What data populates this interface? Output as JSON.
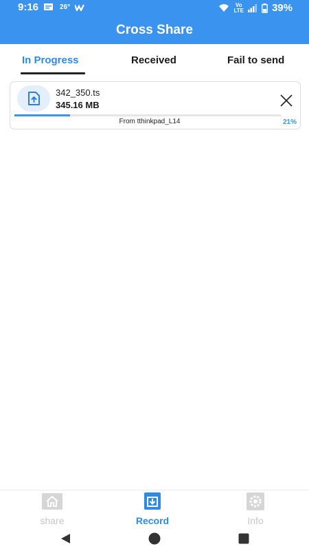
{
  "status_bar": {
    "time": "9:16",
    "temperature": "26°",
    "lte_top": "Vo",
    "lte_bottom": "LTE",
    "battery": "39%"
  },
  "header": {
    "title": "Cross Share",
    "background_color": "#3b93f0"
  },
  "tabs": [
    {
      "label": "In Progress",
      "active": true
    },
    {
      "label": "Received",
      "active": false
    },
    {
      "label": "Fail to send",
      "active": false
    }
  ],
  "transfer": {
    "file_name": "342_350.ts",
    "file_size": "345.16 MB",
    "from": "From tthinkpad_L14",
    "progress_label": "21%",
    "progress_fraction": 0.21,
    "icon": "file-upload-icon",
    "close_icon": "close-icon"
  },
  "bottom_nav": [
    {
      "label": "share",
      "icon": "home-icon",
      "active": false
    },
    {
      "label": "Record",
      "icon": "record-icon",
      "active": true
    },
    {
      "label": "Info",
      "icon": "gear-icon",
      "active": false
    }
  ],
  "system_nav": {
    "back": "back-triangle-icon",
    "home": "home-circle-icon",
    "recents": "recents-square-icon"
  },
  "colors": {
    "accent": "#2f8ae6",
    "inactive": "#c7c7c7"
  }
}
